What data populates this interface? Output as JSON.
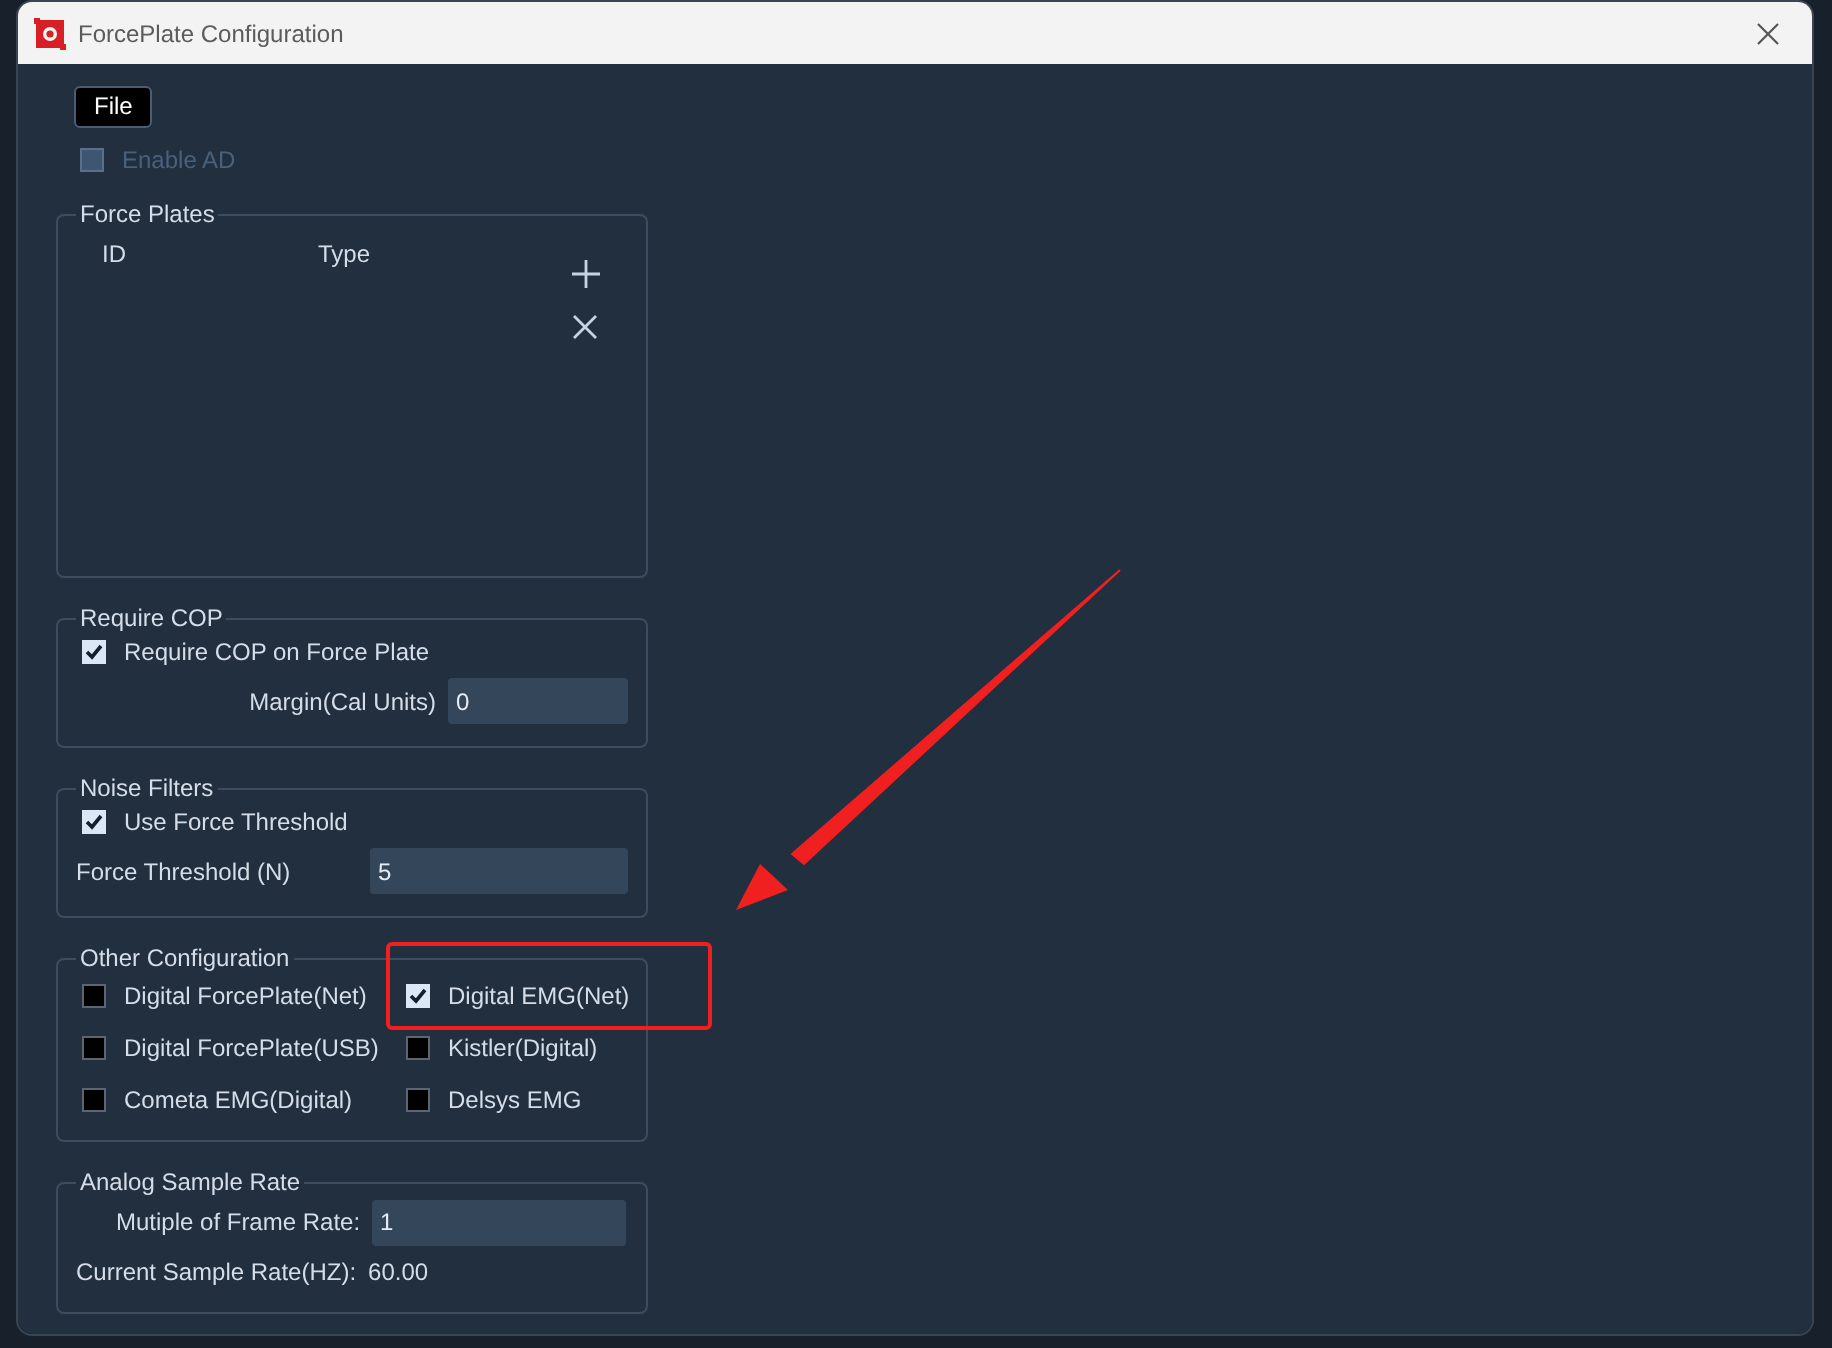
{
  "window": {
    "title": "ForcePlate Configuration"
  },
  "menu": [
    {
      "label": "File"
    }
  ],
  "enable_ad": {
    "label": "Enable AD",
    "checked": false,
    "disabled": true
  },
  "force_plates": {
    "title": "Force Plates",
    "columns": [
      "ID",
      "Type"
    ]
  },
  "require_cop": {
    "title": "Require COP",
    "checkbox": {
      "label": "Require COP on Force Plate",
      "checked": true
    },
    "margin": {
      "label": "Margin(Cal Units)",
      "value": "0"
    }
  },
  "noise_filters": {
    "title": "Noise Filters",
    "checkbox": {
      "label": "Use Force Threshold",
      "checked": true
    },
    "threshold": {
      "label": "Force Threshold (N)",
      "value": "5"
    }
  },
  "other_configuration": {
    "title": "Other Configuration",
    "options": [
      {
        "label": "Digital ForcePlate(Net)",
        "checked": false,
        "highlighted": false
      },
      {
        "label": "Digital EMG(Net)",
        "checked": true,
        "highlighted": true
      },
      {
        "label": "Digital ForcePlate(USB)",
        "checked": false,
        "highlighted": false
      },
      {
        "label": "Kistler(Digital)",
        "checked": false,
        "highlighted": false
      },
      {
        "label": "Cometa EMG(Digital)",
        "checked": false,
        "highlighted": false
      },
      {
        "label": "Delsys EMG",
        "checked": false,
        "highlighted": false
      }
    ]
  },
  "analog_sample_rate": {
    "title": "Analog Sample Rate",
    "multiple": {
      "label": "Mutiple of Frame Rate:",
      "value": "1"
    },
    "current": {
      "label": "Current Sample Rate(HZ):",
      "value": "60.00"
    }
  }
}
